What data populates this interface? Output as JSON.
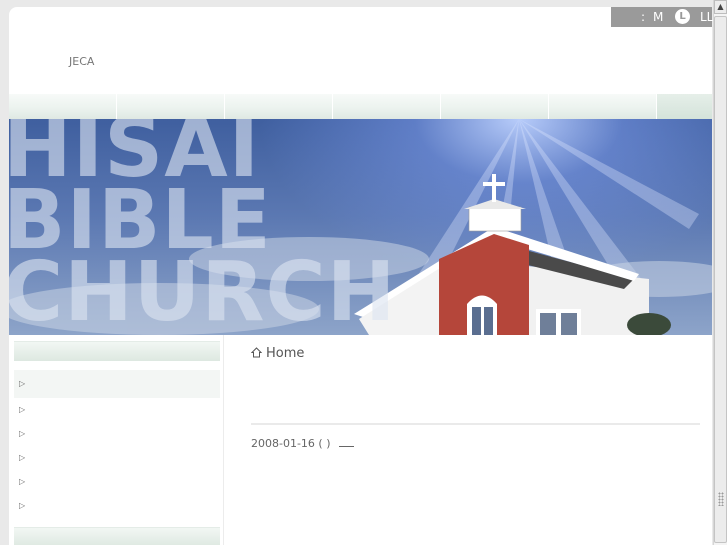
{
  "header": {
    "org_label": "JECA"
  },
  "font_size_switcher": {
    "separator": ":",
    "medium": "M",
    "large": "L",
    "extra_large": "LL"
  },
  "banner": {
    "title_line1": "HISAI",
    "title_line2": "BIBLE",
    "title_line3": "CHURCH"
  },
  "main": {
    "breadcrumb_home": "Home",
    "post_date": "2008-01-16 ( )"
  },
  "colors": {
    "nav_tab": "#ecf3ef",
    "size_bar": "#9a9a9a",
    "sky": "#5b78b2"
  },
  "icons": {
    "home": "home-icon",
    "bullet": "triangle-right-icon",
    "scroll_up": "arrow-up-icon"
  }
}
